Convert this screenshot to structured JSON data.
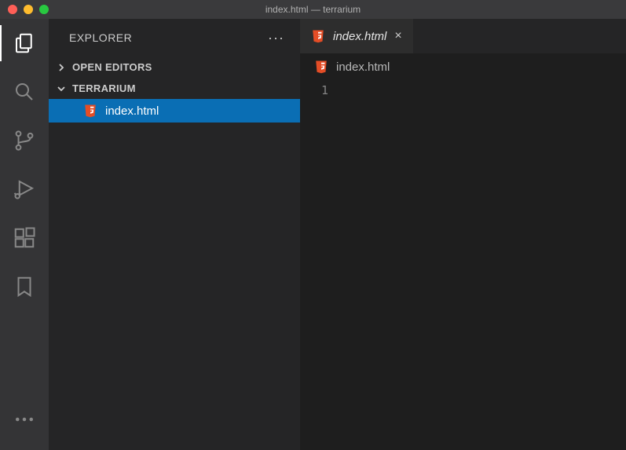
{
  "titlebar": {
    "title": "index.html — terrarium"
  },
  "sidebar": {
    "header_label": "EXPLORER",
    "sections": {
      "open_editors": "OPEN EDITORS",
      "project": "TERRARIUM"
    },
    "files": [
      {
        "name": "index.html"
      }
    ]
  },
  "tabs": [
    {
      "label": "index.html"
    }
  ],
  "breadcrumb": {
    "file": "index.html"
  },
  "editor": {
    "line_number": "1"
  }
}
